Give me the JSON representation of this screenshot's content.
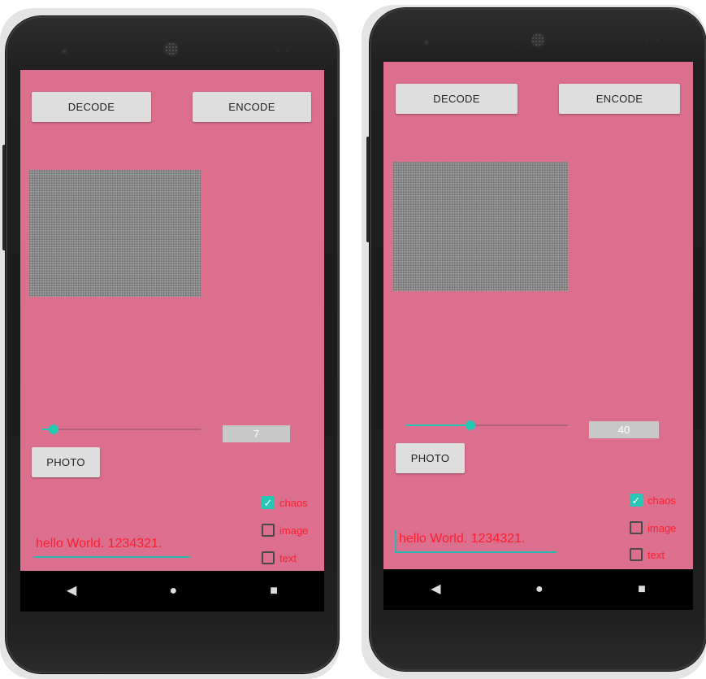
{
  "screens": [
    {
      "decode_label": "DECODE",
      "encode_label": "ENCODE",
      "slider_value": 7,
      "slider_fraction": 0.07,
      "photo_label": "PHOTO",
      "text_value": "hello World. 1234321.",
      "checkboxes": [
        {
          "label": "chaos",
          "checked": true
        },
        {
          "label": "image",
          "checked": false
        },
        {
          "label": "text",
          "checked": false
        }
      ],
      "nav_icons": [
        "back-icon",
        "home-icon",
        "recents-icon"
      ]
    },
    {
      "decode_label": "DECODE",
      "encode_label": "ENCODE",
      "slider_value": 40,
      "slider_fraction": 0.4,
      "photo_label": "PHOTO",
      "text_value": "hello World. 1234321.",
      "checkboxes": [
        {
          "label": "chaos",
          "checked": true
        },
        {
          "label": "image",
          "checked": false
        },
        {
          "label": "text",
          "checked": false
        }
      ],
      "nav_icons": [
        "back-icon",
        "home-icon",
        "recents-icon"
      ]
    }
  ],
  "colors": {
    "screen_background": "#db6f8d",
    "accent": "#27c7b5",
    "label_red": "#ff1e2d",
    "button_gray": "#dedede"
  }
}
